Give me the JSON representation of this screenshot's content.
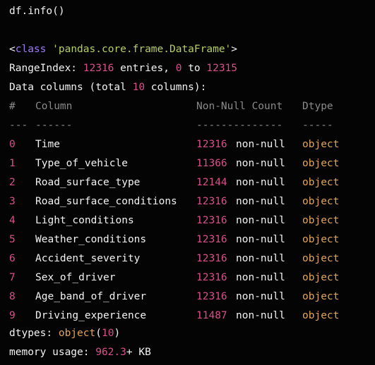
{
  "code": {
    "command": "df.info()"
  },
  "output": {
    "class_open": "<",
    "class_kw": "class",
    "class_name": "'pandas.core.frame.DataFrame'",
    "class_close": ">",
    "range_label": "RangeIndex: ",
    "range_count": "12316",
    "range_mid": " entries, ",
    "range_start": "0",
    "range_to": " to ",
    "range_end": "12315",
    "columns_prefix": "Data columns (total ",
    "columns_total": "10",
    "columns_suffix": " columns):",
    "header": {
      "idx": "#",
      "column": "Column",
      "count": "Non-Null Count",
      "dtype": "Dtype"
    },
    "separator": {
      "idx": "---",
      "column": "------",
      "count": "--------------",
      "dtype": "-----"
    },
    "rows": [
      {
        "idx": "0",
        "column": "Time",
        "count": "12316",
        "nn": "non-null",
        "dtype": "object"
      },
      {
        "idx": "1",
        "column": "Type_of_vehicle",
        "count": "11366",
        "nn": "non-null",
        "dtype": "object"
      },
      {
        "idx": "2",
        "column": "Road_surface_type",
        "count": "12144",
        "nn": "non-null",
        "dtype": "object"
      },
      {
        "idx": "3",
        "column": "Road_surface_conditions",
        "count": "12316",
        "nn": "non-null",
        "dtype": "object"
      },
      {
        "idx": "4",
        "column": "Light_conditions",
        "count": "12316",
        "nn": "non-null",
        "dtype": "object"
      },
      {
        "idx": "5",
        "column": "Weather_conditions",
        "count": "12316",
        "nn": "non-null",
        "dtype": "object"
      },
      {
        "idx": "6",
        "column": "Accident_severity",
        "count": "12316",
        "nn": "non-null",
        "dtype": "object"
      },
      {
        "idx": "7",
        "column": "Sex_of_driver",
        "count": "12316",
        "nn": "non-null",
        "dtype": "object"
      },
      {
        "idx": "8",
        "column": "Age_band_of_driver",
        "count": "12316",
        "nn": "non-null",
        "dtype": "object"
      },
      {
        "idx": "9",
        "column": "Driving_experience",
        "count": "11487",
        "nn": "non-null",
        "dtype": "object"
      }
    ],
    "dtypes_label": "dtypes: ",
    "dtypes_type": "object",
    "dtypes_open": "(",
    "dtypes_count": "10",
    "dtypes_close": ")",
    "memory_label": "memory usage: ",
    "memory_value": "962.3",
    "memory_unit": "+ KB"
  },
  "colors": {
    "background": "#040404",
    "text": "#ececec",
    "number": "#d94f8a",
    "keyword": "#9d7cf2",
    "string": "#b6cf64",
    "dtype": "#e0a457",
    "dim": "#8a8a8a"
  }
}
